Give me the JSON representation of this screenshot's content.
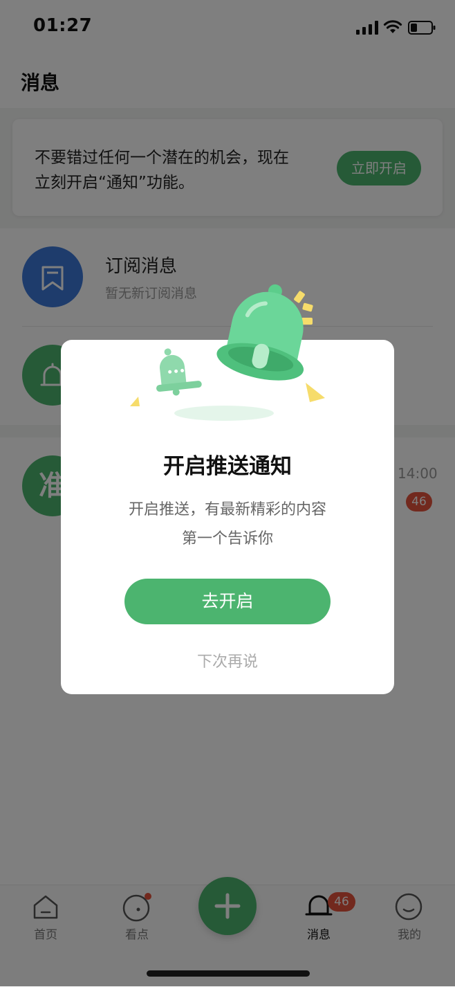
{
  "status_bar": {
    "time": "01:27"
  },
  "page": {
    "title": "消息"
  },
  "banner": {
    "text_line1": "不要错过任何一个潜在的机会，现在",
    "text_line2": "立刻开启“通知”功能。",
    "button": "立即开启"
  },
  "list": {
    "items": [
      {
        "title": "订阅消息",
        "subtitle": "暂无新订阅消息",
        "icon": "bookmark-icon",
        "color": "#3d78d8"
      },
      {
        "icon": "bell-icon",
        "color": "#4cb46f"
      },
      {
        "avatar_text": "准",
        "time": "14:00",
        "badge": "46",
        "color": "#4cb46f"
      }
    ]
  },
  "modal": {
    "title": "开启推送通知",
    "desc_line1": "开启推送，有最新精彩的内容",
    "desc_line2": "第一个告诉你",
    "primary_button": "去开启",
    "secondary_button": "下次再说"
  },
  "tabbar": {
    "tabs": [
      {
        "label": "首页",
        "icon": "home-icon"
      },
      {
        "label": "看点",
        "icon": "discover-icon"
      },
      {
        "label": "消息",
        "icon": "bell-icon",
        "badge": "46",
        "active": true
      },
      {
        "label": "我的",
        "icon": "profile-icon"
      }
    ],
    "fab_icon": "plus-icon"
  },
  "colors": {
    "accent": "#4cb46f",
    "badge": "#e5533d",
    "blue": "#3d78d8"
  }
}
